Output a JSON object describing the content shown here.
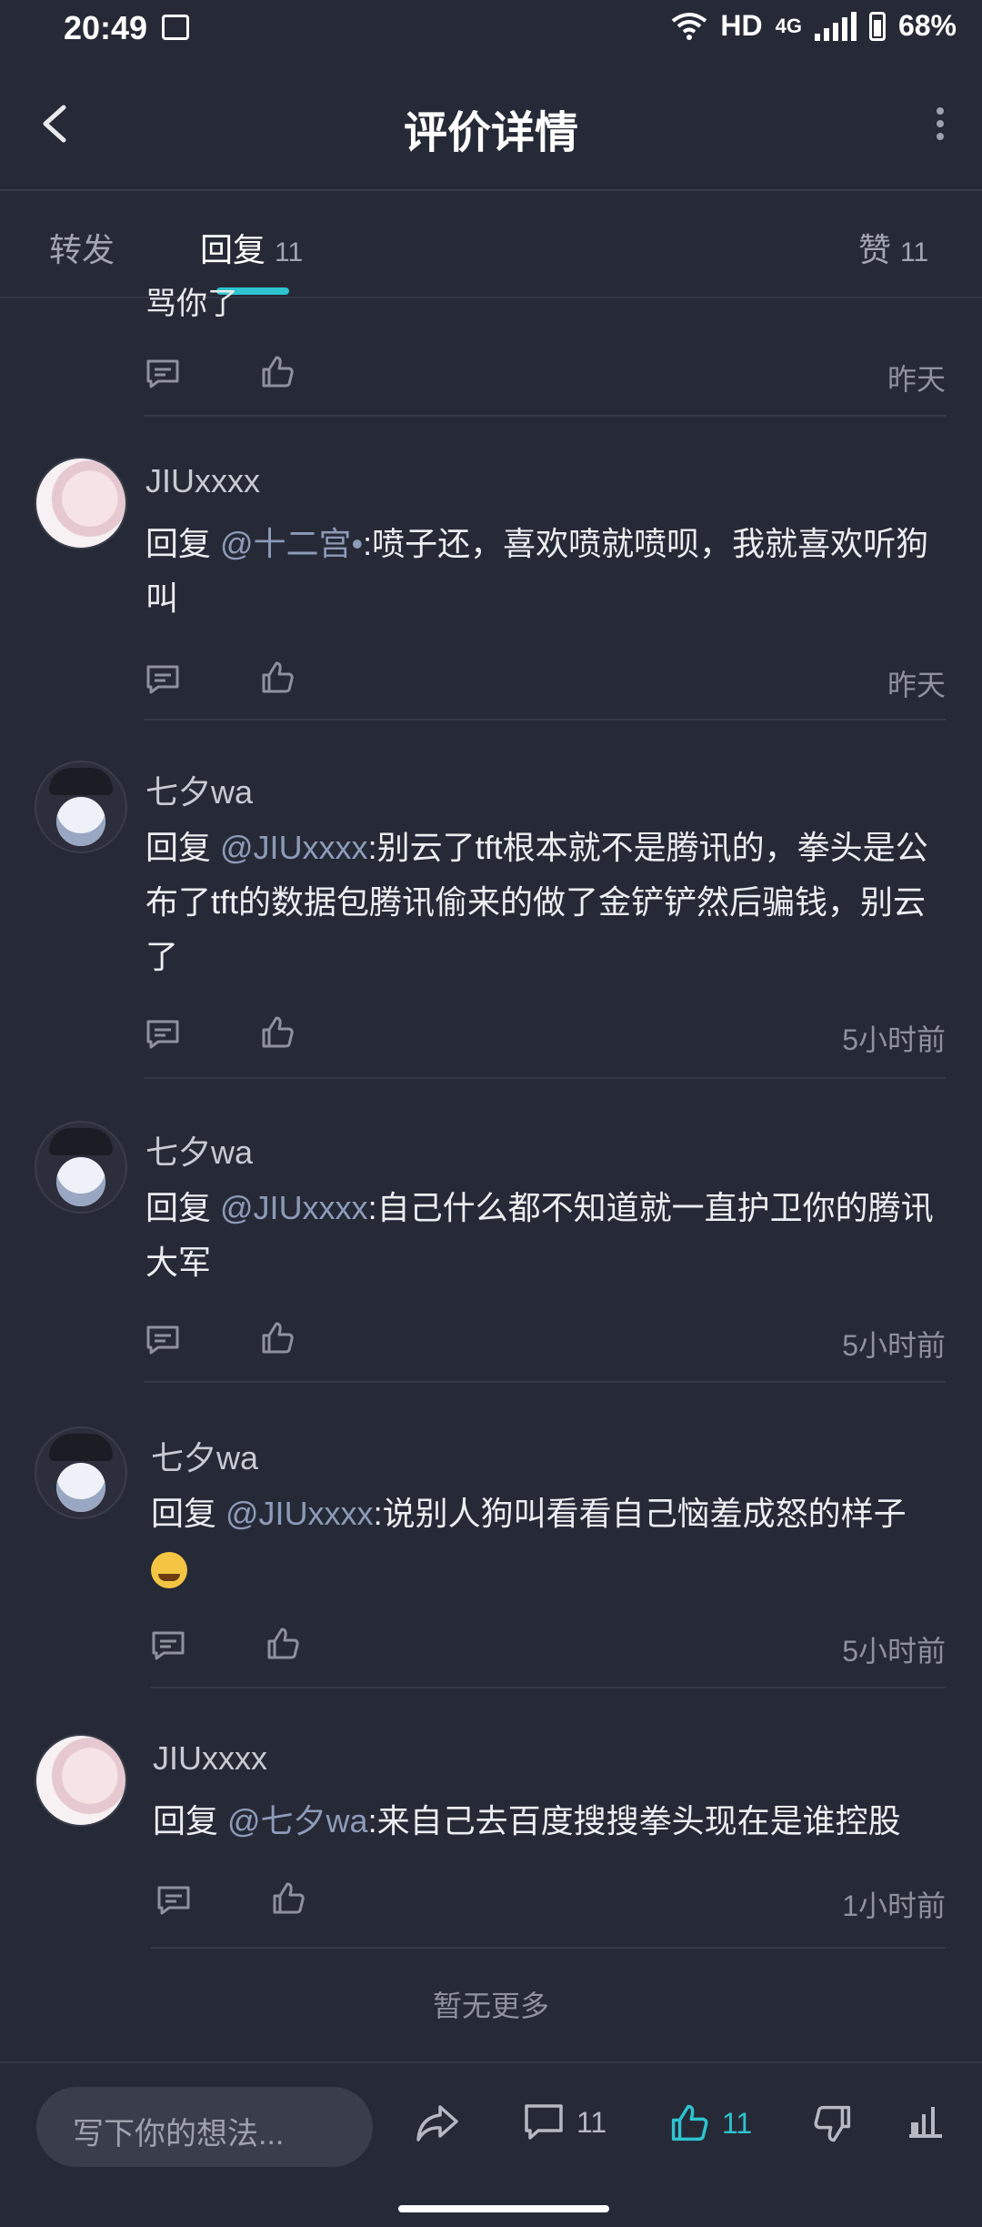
{
  "status": {
    "time": "20:49",
    "net": "HD",
    "signal": "4G",
    "battery": "68%"
  },
  "header": {
    "title": "评价详情"
  },
  "tabs": [
    {
      "label": "转发",
      "count": ""
    },
    {
      "label": "回复",
      "count": "11"
    },
    {
      "label": "赞",
      "count": "11"
    }
  ],
  "partial_top": {
    "text": "骂你了",
    "time": "昨天"
  },
  "comments": [
    {
      "user": "JIUxxxx",
      "prefix": "回复 ",
      "mention": "@十二宫•",
      "text": ":喷子还，喜欢喷就喷呗，我就喜欢听狗叫",
      "time": "昨天"
    },
    {
      "user": "七夕wa",
      "prefix": "回复 ",
      "mention": "@JIUxxxx",
      "text": ":别云了tft根本就不是腾讯的，拳头是公布了tft的数据包腾讯偷来的做了金铲铲然后骗钱，别云了",
      "time": "5小时前"
    },
    {
      "user": "七夕wa",
      "prefix": "回复 ",
      "mention": "@JIUxxxx",
      "text": ":自己什么都不知道就一直护卫你的腾讯大军",
      "time": "5小时前"
    },
    {
      "user": "七夕wa",
      "prefix": "回复 ",
      "mention": "@JIUxxxx",
      "text": ":说别人狗叫看看自己恼羞成怒的样子",
      "time": "5小时前"
    },
    {
      "user": "JIUxxxx",
      "prefix": "回复 ",
      "mention": "@七夕wa",
      "text": ":来自己去百度搜搜拳头现在是谁控股",
      "time": "1小时前"
    }
  ],
  "footer": {
    "no_more": "暂无更多"
  },
  "bottom": {
    "placeholder": "写下你的想法...",
    "comment_count": "11",
    "like_count": "11"
  },
  "colors": {
    "background": "#262936",
    "accent": "#2ec4d0"
  }
}
